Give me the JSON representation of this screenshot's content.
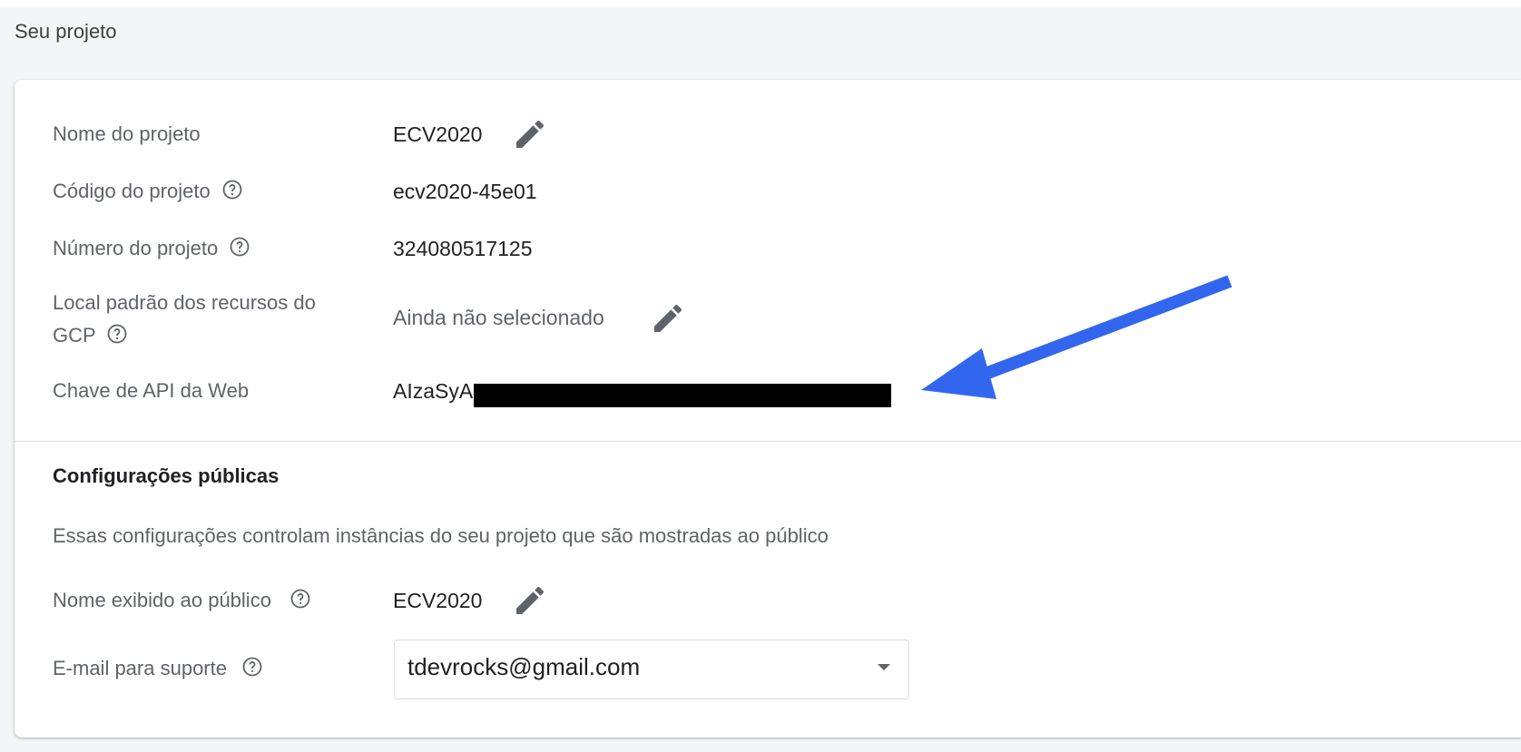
{
  "section": {
    "title": "Seu projeto"
  },
  "project": {
    "rows": [
      {
        "label": "Nome do projeto",
        "value": "ECV2020"
      },
      {
        "label": "Código do projeto",
        "value": "ecv2020-45e01"
      },
      {
        "label": "Número do projeto",
        "value": "324080517125"
      },
      {
        "label_line1": "Local padrão dos recursos do",
        "label_line2": "GCP",
        "value": "Ainda não selecionado"
      },
      {
        "label": "Chave de API da Web",
        "value": "AIzaSyA"
      }
    ]
  },
  "public": {
    "title": "Configurações públicas",
    "description": "Essas configurações controlam instâncias do seu projeto que são mostradas ao público",
    "display_name_label": "Nome exibido ao público",
    "display_name_value": "ECV2020",
    "support_email_label": "E-mail para suporte",
    "support_email_value": "tdevrocks@gmail.com"
  },
  "icons": {
    "edit": "pencil-icon",
    "help": "help-circle-icon",
    "dropdown": "caret-down-icon",
    "annotation": "blue-arrow"
  },
  "colors": {
    "annotation_arrow": "#3366ee"
  }
}
